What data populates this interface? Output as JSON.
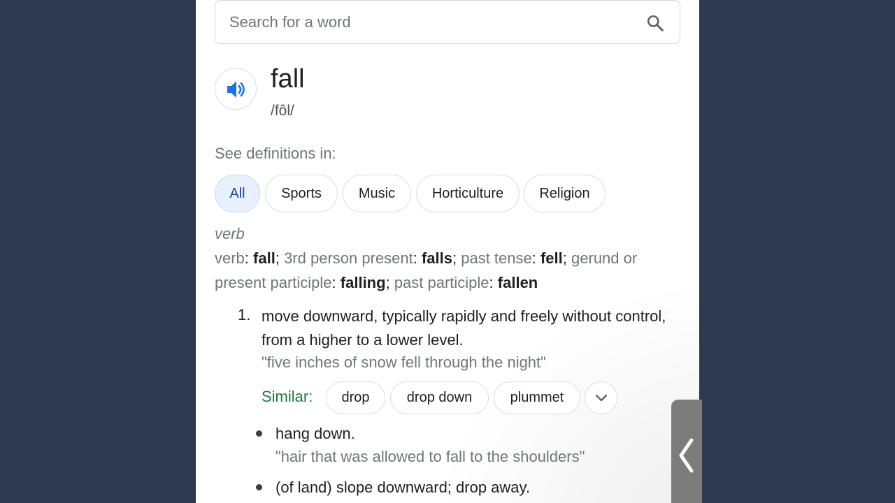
{
  "search": {
    "placeholder": "Search for a word"
  },
  "entry": {
    "word": "fall",
    "phonetic": "/fôl/",
    "see_definitions_label": "See definitions in:",
    "categories": [
      "All",
      "Sports",
      "Music",
      "Horticulture",
      "Religion"
    ],
    "selected_category": "All",
    "part_of_speech": "verb",
    "forms": {
      "verb_label": "verb",
      "verb": "fall",
      "third_person_label": "3rd person present",
      "third_person": "falls",
      "past_tense_label": "past tense",
      "past_tense": "fell",
      "gerund_label": "gerund or present participle",
      "gerund": "falling",
      "past_participle_label": "past participle",
      "past_participle": "fallen"
    },
    "definition_1": {
      "number": "1.",
      "text": "move downward, typically rapidly and freely without control, from a higher to a lower level.",
      "example": "\"five inches of snow fell through the night\"",
      "similar_label": "Similar:",
      "similar": [
        "drop",
        "drop down",
        "plummet"
      ]
    },
    "sub_definitions": [
      {
        "text": "hang down.",
        "example": "\"hair that was allowed to fall to the shoulders\""
      },
      {
        "text": "(of land) slope downward; drop away."
      }
    ]
  },
  "icons": {
    "search": "search-icon",
    "speaker": "speaker-icon",
    "expand": "chevron-down-icon",
    "side_tab": "chevron-left-icon"
  },
  "colors": {
    "background": "#2d3a4f",
    "accent_blue": "#1a73e8",
    "similar_green": "#188038",
    "selected_chip": "#e8f0fe"
  }
}
